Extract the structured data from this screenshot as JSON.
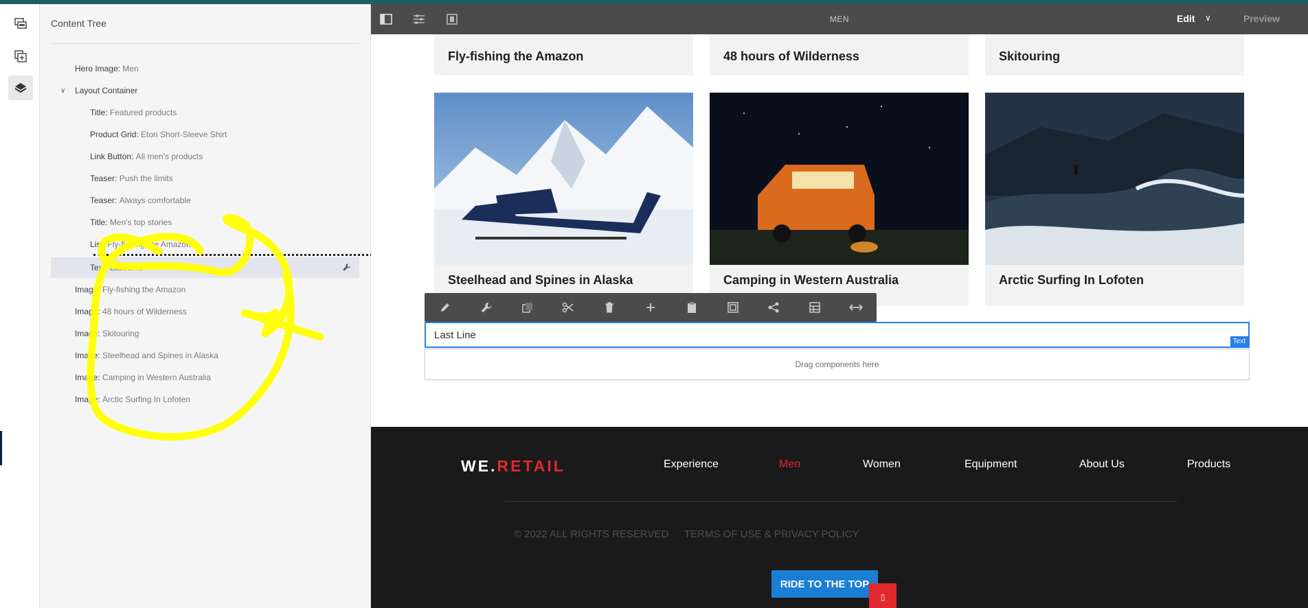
{
  "editor": {
    "page_title": "MEN",
    "mode": "Edit",
    "preview": "Preview"
  },
  "content_tree": {
    "title": "Content Tree",
    "items": [
      {
        "type": "Hero Image",
        "value": "Men"
      },
      {
        "type": "Layout Container",
        "value": ""
      },
      {
        "type": "Title",
        "value": "Featured products"
      },
      {
        "type": "Product Grid",
        "value": "Eton Short-Sleeve Shirt"
      },
      {
        "type": "Link Button",
        "value": "All men's products"
      },
      {
        "type": "Teaser",
        "value": "Push the limits"
      },
      {
        "type": "Teaser",
        "value": "Always comfortable"
      },
      {
        "type": "Title",
        "value": "Men's top stories"
      },
      {
        "type": "List",
        "value": "Fly-fishing the Amazon"
      },
      {
        "type": "Text",
        "value": "Last Line"
      },
      {
        "type": "Image",
        "value": "Fly-fishing the Amazon"
      },
      {
        "type": "Image",
        "value": "48 hours of Wilderness"
      },
      {
        "type": "Image",
        "value": "Skitouring"
      },
      {
        "type": "Image",
        "value": "Steelhead and Spines in Alaska"
      },
      {
        "type": "Image",
        "value": "Camping in Western Australia"
      },
      {
        "type": "Image",
        "value": "Arctic Surfing In Lofoten"
      }
    ]
  },
  "cards": {
    "top": [
      "Fly-fishing the Amazon",
      "48 hours of Wilderness",
      "Skitouring"
    ],
    "bottom": [
      "Steelhead and Spines in Alaska",
      "Camping in Western Australia",
      "Arctic Surfing In Lofoten"
    ]
  },
  "text_component": {
    "value": "Last Line",
    "tag": "Text"
  },
  "drag_zone": "Drag components here",
  "footer": {
    "logo_a": "WE.",
    "logo_b": "RETAIL",
    "nav": [
      "Experience",
      "Men",
      "Women",
      "Equipment",
      "About Us",
      "Products"
    ],
    "active": "Men",
    "copyright": "© 2022 ALL RIGHTS RESERVED",
    "terms": "TERMS OF USE & PRIVACY POLICY",
    "ride_button": "RIDE TO THE TOP"
  },
  "colors": {
    "accent_blue": "#2680eb",
    "brand_red": "#e0282e",
    "toolbar": "#4b4b4b",
    "footer_bg": "#1a1a1a",
    "annotation_yellow": "#ffff00"
  },
  "icons": [
    "side-panel-icon",
    "properties-icon",
    "emulator-icon",
    "page-icon",
    "components-icon",
    "layers-icon",
    "wrench-icon",
    "pencil-icon",
    "copy-icon",
    "cut-icon",
    "trash-icon",
    "plus-icon",
    "paste-icon",
    "group-icon",
    "parent-icon",
    "layout-icon",
    "resize-icon"
  ]
}
